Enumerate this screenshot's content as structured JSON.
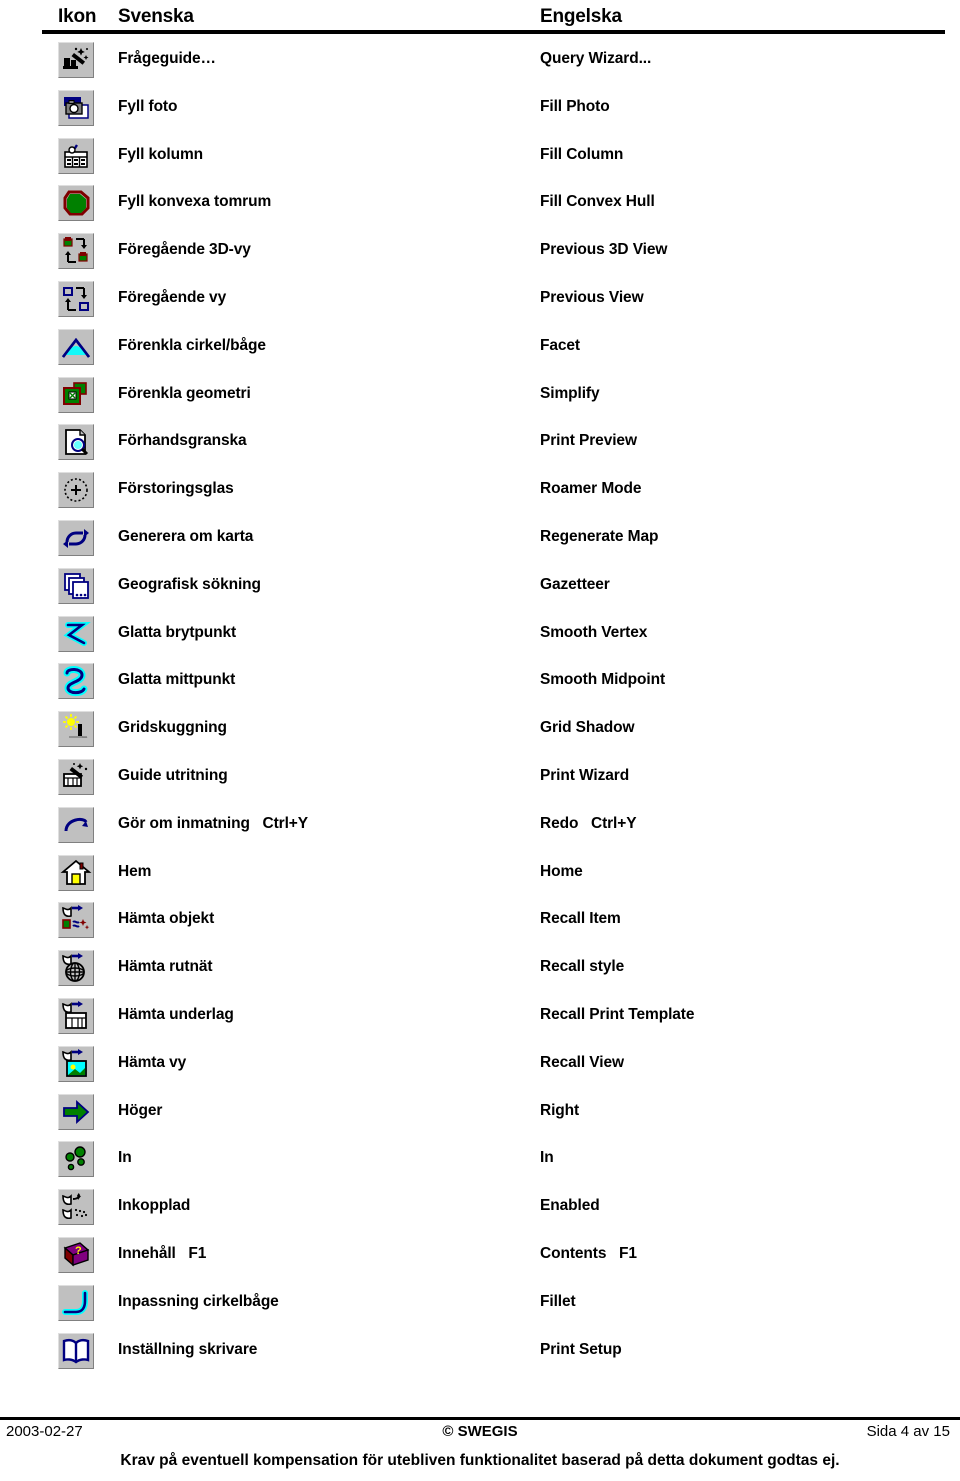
{
  "header": {
    "col_icon": "Ikon",
    "col_swedish": "Svenska",
    "col_english": "Engelska"
  },
  "rows": [
    {
      "icon": "query-wizard-icon",
      "sv": "Frågeguide…",
      "en": "Query Wizard..."
    },
    {
      "icon": "fill-photo-icon",
      "sv": "Fyll foto",
      "en": "Fill Photo"
    },
    {
      "icon": "fill-column-icon",
      "sv": "Fyll kolumn",
      "en": "Fill Column"
    },
    {
      "icon": "fill-convex-hull-icon",
      "sv": "Fyll konvexa tomrum",
      "en": "Fill Convex Hull"
    },
    {
      "icon": "previous-3d-view-icon",
      "sv": "Föregående 3D-vy",
      "en": "Previous 3D View"
    },
    {
      "icon": "previous-view-icon",
      "sv": "Föregående vy",
      "en": "Previous View"
    },
    {
      "icon": "facet-icon",
      "sv": "Förenkla cirkel/båge",
      "en": "Facet"
    },
    {
      "icon": "simplify-icon",
      "sv": "Förenkla geometri",
      "en": "Simplify"
    },
    {
      "icon": "print-preview-icon",
      "sv": "Förhandsgranska",
      "en": "Print Preview"
    },
    {
      "icon": "roamer-mode-icon",
      "sv": "Förstoringsglas",
      "en": "Roamer Mode"
    },
    {
      "icon": "regenerate-map-icon",
      "sv": "Generera om karta",
      "en": "Regenerate Map"
    },
    {
      "icon": "gazetteer-icon",
      "sv": "Geografisk sökning",
      "en": "Gazetteer"
    },
    {
      "icon": "smooth-vertex-icon",
      "sv": "Glatta brytpunkt",
      "en": "Smooth Vertex"
    },
    {
      "icon": "smooth-midpoint-icon",
      "sv": "Glatta mittpunkt",
      "en": "Smooth Midpoint"
    },
    {
      "icon": "grid-shadow-icon",
      "sv": "Gridskuggning",
      "en": "Grid Shadow"
    },
    {
      "icon": "print-wizard-icon",
      "sv": "Guide utritning",
      "en": "Print Wizard"
    },
    {
      "icon": "redo-icon",
      "sv": "Gör om inmatning   Ctrl+Y",
      "en": "Redo   Ctrl+Y"
    },
    {
      "icon": "home-icon",
      "sv": "Hem",
      "en": "Home"
    },
    {
      "icon": "recall-item-icon",
      "sv": "Hämta objekt",
      "en": "Recall Item"
    },
    {
      "icon": "recall-style-icon",
      "sv": "Hämta rutnät",
      "en": "Recall style"
    },
    {
      "icon": "recall-print-template-icon",
      "sv": "Hämta underlag",
      "en": "Recall Print Template"
    },
    {
      "icon": "recall-view-icon",
      "sv": "Hämta vy",
      "en": "Recall View"
    },
    {
      "icon": "right-arrow-icon",
      "sv": "Höger",
      "en": "Right"
    },
    {
      "icon": "zoom-in-icon",
      "sv": "In",
      "en": "In"
    },
    {
      "icon": "enabled-icon",
      "sv": "Inkopplad",
      "en": "Enabled"
    },
    {
      "icon": "contents-help-icon",
      "sv": "Innehåll   F1",
      "en": "Contents   F1"
    },
    {
      "icon": "fillet-icon",
      "sv": "Inpassning cirkelbåge",
      "en": "Fillet"
    },
    {
      "icon": "print-setup-icon",
      "sv": "Inställning skrivare",
      "en": "Print Setup"
    }
  ],
  "footer": {
    "date": "2003-02-27",
    "copyright": "© SWEGIS",
    "page": "Sida 4 av 15",
    "disclaimer": "Krav på eventuell kompensation för utebliven funktionalitet baserad på detta dokument godtas ej."
  },
  "colors": {
    "button_face": "#c0c0c0",
    "text": "#000000",
    "green": "#008000",
    "dark_blue": "#000080",
    "cyan": "#00ffff",
    "yellow": "#ffff00",
    "dark_red": "#800000",
    "purple": "#800080"
  }
}
